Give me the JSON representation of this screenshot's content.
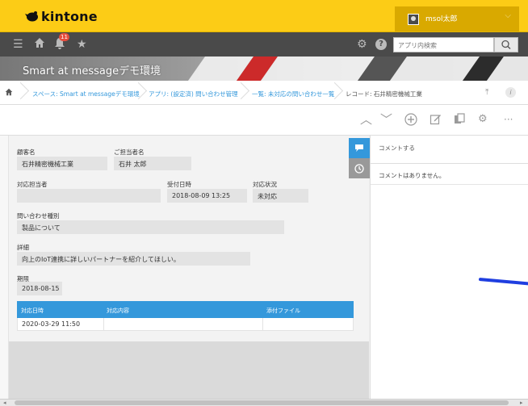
{
  "app": {
    "logo_text": "kintone",
    "brand_color": "#fccc16"
  },
  "user": {
    "name": "msol太郎"
  },
  "nav": {
    "notification_count": "11",
    "search_placeholder": "アプリ内検索"
  },
  "banner": {
    "title": "Smart at messageデモ環境"
  },
  "breadcrumb": {
    "items": [
      "スペース: Smart at messageデモ環境",
      "アプリ: (設定済) 問い合わせ管理",
      "一覧: 未対応の問い合わせ一覧",
      "レコード: 石井精密機械工業"
    ]
  },
  "record": {
    "customer_label": "顧客名",
    "customer_value": "石井精密機械工業",
    "contact_label": "ご担当者名",
    "contact_value": "石井 太郎",
    "assignee_label": "対応担当者",
    "assignee_value": "",
    "received_label": "受付日時",
    "received_value": "2018-08-09 13:25",
    "status_label": "対応状況",
    "status_value": "未対応",
    "type_label": "問い合わせ種別",
    "type_value": "製品について",
    "detail_label": "詳細",
    "detail_value": "向上のIoT連携に詳しいパートナーを紹介してほしい。",
    "deadline_label": "期限",
    "deadline_value": "2018-08-15",
    "subtable": {
      "headers": [
        "対応日時",
        "対応内容",
        "添付ファイル"
      ],
      "rows": [
        [
          "2020-03-29 11:50",
          "",
          ""
        ]
      ]
    }
  },
  "comments": {
    "input_placeholder": "コメントする",
    "empty_text": "コメントはありません。"
  }
}
